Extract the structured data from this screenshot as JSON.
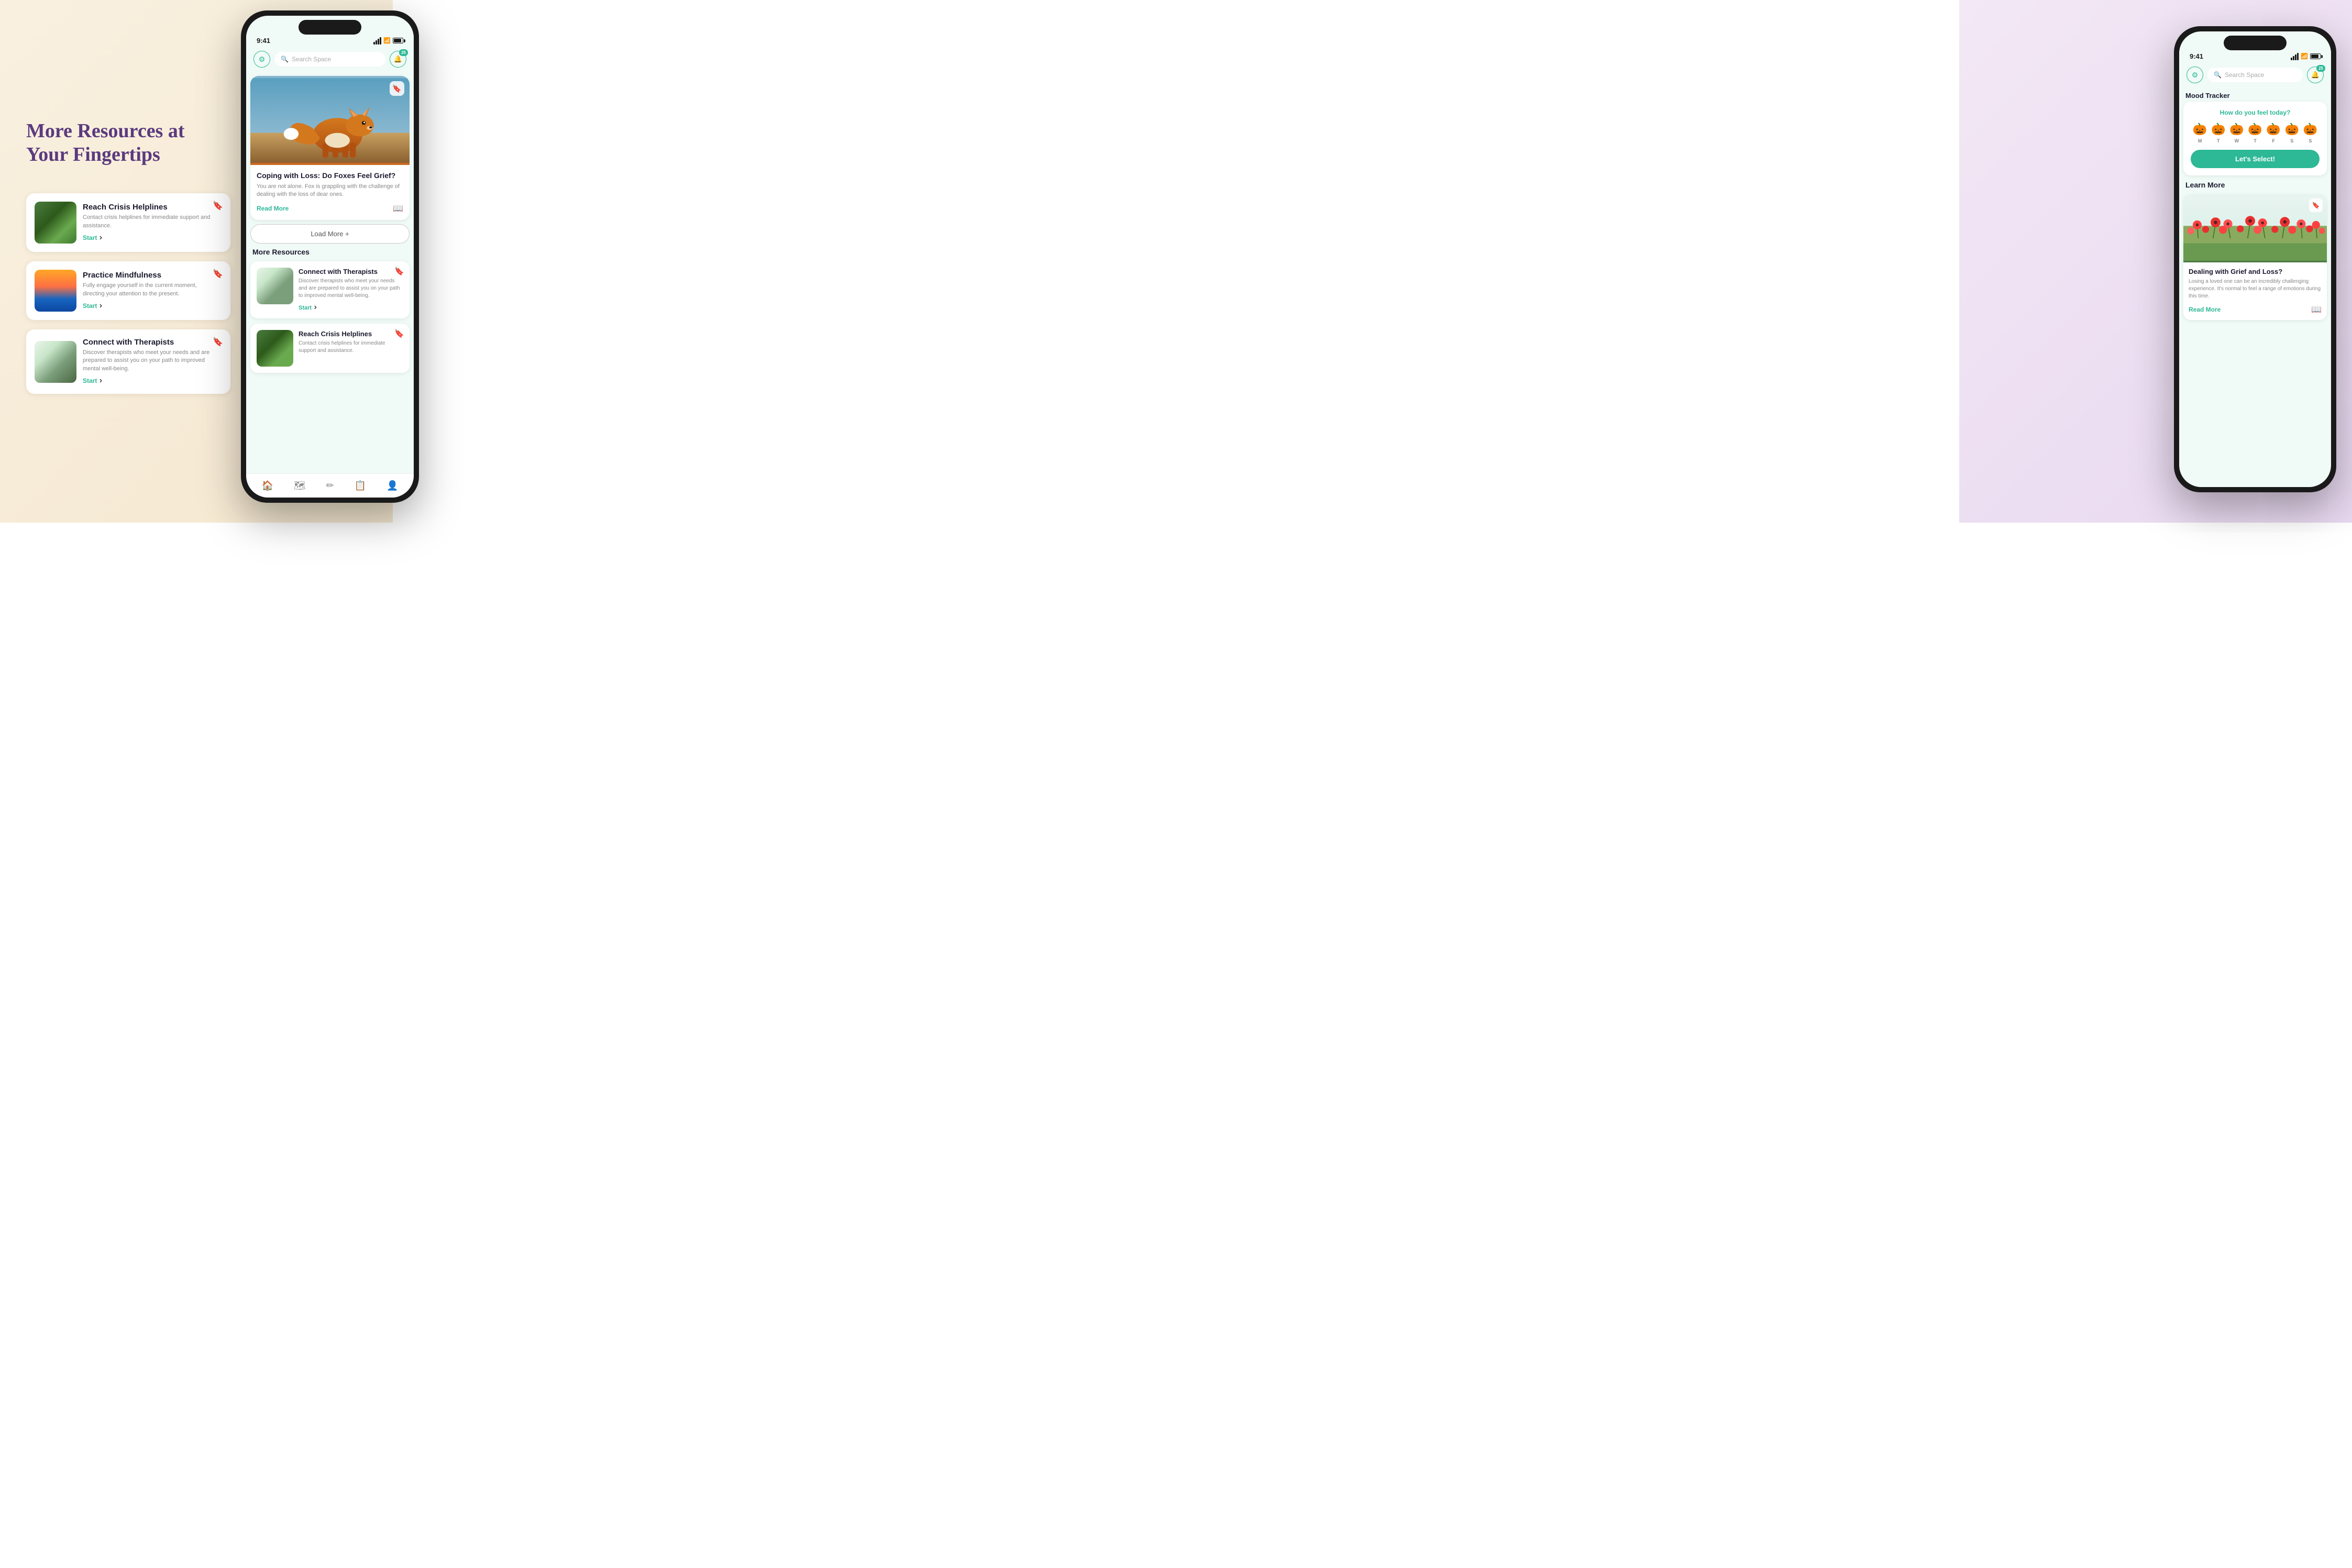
{
  "headline": "More Resources at Your Fingertips",
  "left_cards": [
    {
      "title": "Reach Crisis Helplines",
      "desc": "Contact crisis helplines for immediate support and assistance.",
      "start": "Start",
      "bookmarked": false
    },
    {
      "title": "Practice Mindfulness",
      "desc": "Fully engage yourself in the current moment, directing your attention to the present.",
      "start": "Start",
      "bookmarked": false
    },
    {
      "title": "Connect with Therapists",
      "desc": "Discover therapists who meet your needs and are prepared to assist you on your path to improved mental well-being.",
      "start": "Start",
      "bookmarked": true
    }
  ],
  "phone1": {
    "status_time": "9:41",
    "search_placeholder": "Search Space",
    "bell_count": "25",
    "featured_article": {
      "title": "Coping with Loss: Do Foxes Feel Grief?",
      "desc": "You are not alone. Fox is grappling with the challenge of dealing with the loss of dear ones.",
      "read_more": "Read More",
      "bookmarked": false
    },
    "load_more": "Load More +",
    "more_resources_title": "More Resources",
    "resource_cards": [
      {
        "title": "Connect with Therapists",
        "desc": "Discover therapists who meet your needs and are prepared to assist you on your path to improved mental well-being.",
        "start": "Start",
        "bookmarked": true
      },
      {
        "title": "Reach Crisis Helplines",
        "desc": "Contact crisis helplines for immediate support and assistance.",
        "start": "Start",
        "bookmarked": false
      }
    ],
    "nav_items": [
      "home",
      "map",
      "tools",
      "list",
      "profile"
    ]
  },
  "phone2": {
    "status_time": "9:41",
    "search_placeholder": "Search Space",
    "bell_count": "25",
    "mood_tracker": {
      "section_title": "Mood Tracker",
      "question": "How do you feel today?",
      "days": [
        "M",
        "T",
        "W",
        "T",
        "F",
        "S",
        "S"
      ],
      "button": "Let's Select!"
    },
    "learn_more": {
      "section_title": "Learn More",
      "article": {
        "title": "Dealing with Grief and Loss?",
        "desc": "Losing a loved one can be an incredibly challenging experience. It's normal to feel a range of emotions during this time.",
        "read_more": "Read More"
      }
    }
  }
}
